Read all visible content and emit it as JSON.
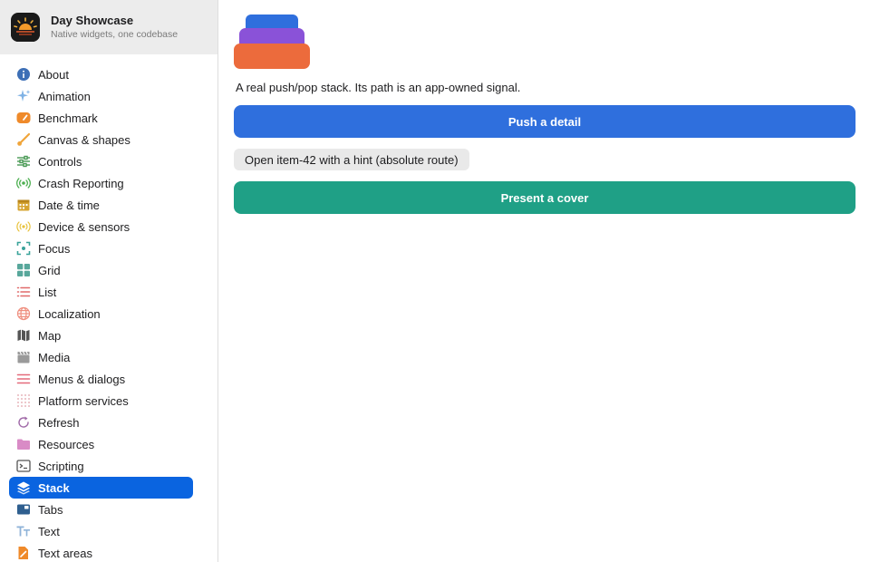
{
  "app": {
    "title": "Day Showcase",
    "subtitle": "Native widgets, one codebase",
    "icon": "sunrise-app-icon"
  },
  "sidebar": {
    "active": "Stack",
    "items": [
      {
        "label": "About",
        "icon": "info-icon",
        "color": "#3d6fb6"
      },
      {
        "label": "Animation",
        "icon": "sparkles-icon",
        "color": "#7fb2e5"
      },
      {
        "label": "Benchmark",
        "icon": "speedometer-icon",
        "color": "#ef8a2a"
      },
      {
        "label": "Canvas & shapes",
        "icon": "paintbrush-icon",
        "color": "#f0a53a"
      },
      {
        "label": "Controls",
        "icon": "sliders-icon",
        "color": "#4a9a55"
      },
      {
        "label": "Crash Reporting",
        "icon": "broadcast-icon",
        "color": "#4caf50"
      },
      {
        "label": "Date & time",
        "icon": "calendar-icon",
        "color": "#d6a431"
      },
      {
        "label": "Device & sensors",
        "icon": "sensor-icon",
        "color": "#e8c23a"
      },
      {
        "label": "Focus",
        "icon": "focus-icon",
        "color": "#3aa39a"
      },
      {
        "label": "Grid",
        "icon": "grid-icon",
        "color": "#58a79b"
      },
      {
        "label": "List",
        "icon": "list-icon",
        "color": "#e06a6a"
      },
      {
        "label": "Localization",
        "icon": "globe-icon",
        "color": "#ef8f7f"
      },
      {
        "label": "Map",
        "icon": "map-icon",
        "color": "#555555"
      },
      {
        "label": "Media",
        "icon": "clapperboard-icon",
        "color": "#9a9a9a"
      },
      {
        "label": "Menus & dialogs",
        "icon": "menu-lines-icon",
        "color": "#e46a7a"
      },
      {
        "label": "Platform services",
        "icon": "dots-grid-icon",
        "color": "#e0a0a8"
      },
      {
        "label": "Refresh",
        "icon": "refresh-icon",
        "color": "#a06aa8"
      },
      {
        "label": "Resources",
        "icon": "folder-icon",
        "color": "#d98bc6"
      },
      {
        "label": "Scripting",
        "icon": "terminal-icon",
        "color": "#555555"
      },
      {
        "label": "Stack",
        "icon": "layers-icon",
        "color": "#ffffff"
      },
      {
        "label": "Tabs",
        "icon": "tabs-icon",
        "color": "#2f5f8f"
      },
      {
        "label": "Text",
        "icon": "text-icon",
        "color": "#8fb3d8"
      },
      {
        "label": "Text areas",
        "icon": "document-pencil-icon",
        "color": "#ef8a2a"
      }
    ]
  },
  "main": {
    "caption": "A real push/pop stack. Its path is an app-owned signal.",
    "push_button": "Push a detail",
    "open_button": "Open item-42 with a hint (absolute route)",
    "cover_button": "Present a cover",
    "stack_colors": [
      "#2f6fdd",
      "#8a52d8",
      "#ec6b3c"
    ]
  }
}
